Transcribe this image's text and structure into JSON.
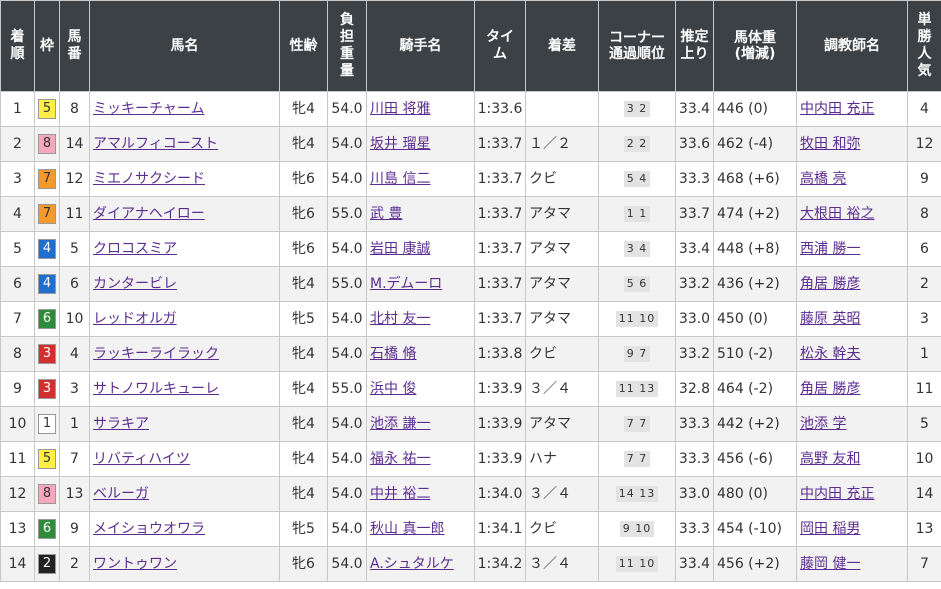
{
  "headers": {
    "rank": "着順",
    "waku": "枠",
    "umaban": "馬番",
    "horse": "馬名",
    "sexage": "性齢",
    "weight_carried": "負担重量",
    "jockey": "騎手名",
    "time": "タイム",
    "margin": "着差",
    "corner_line1": "コーナー",
    "corner_line2": "通過順位",
    "last3f": "推定上り",
    "body_line1": "馬体重",
    "body_line2": "(増減)",
    "trainer": "調教師名",
    "popularity": "単勝人気"
  },
  "waku_colors": {
    "1": {
      "bg": "#ffffff",
      "fg": "#333333"
    },
    "2": {
      "bg": "#222222",
      "fg": "#ffffff"
    },
    "3": {
      "bg": "#d32f2f",
      "fg": "#ffffff"
    },
    "4": {
      "bg": "#1f6fd1",
      "fg": "#ffffff"
    },
    "5": {
      "bg": "#ffee44",
      "fg": "#333333"
    },
    "6": {
      "bg": "#2e8b3a",
      "fg": "#ffffff"
    },
    "7": {
      "bg": "#f39a2b",
      "fg": "#333333"
    },
    "8": {
      "bg": "#f6a9be",
      "fg": "#333333"
    }
  },
  "rows": [
    {
      "rank": "1",
      "waku": "5",
      "umaban": "8",
      "horse": "ミッキーチャーム",
      "sexage": "牝4",
      "weight": "54.0",
      "jockey": "川田 将雅",
      "time": "1:33.6",
      "margin": "",
      "corner": "3 2",
      "last3f": "33.4",
      "body": "446 (0)",
      "trainer": "中内田 充正",
      "pop": "4"
    },
    {
      "rank": "2",
      "waku": "8",
      "umaban": "14",
      "horse": "アマルフィコースト",
      "sexage": "牝4",
      "weight": "54.0",
      "jockey": "坂井 瑠星",
      "time": "1:33.7",
      "margin": "１／２",
      "corner": "2 2",
      "last3f": "33.6",
      "body": "462 (-4)",
      "trainer": "牧田 和弥",
      "pop": "12"
    },
    {
      "rank": "3",
      "waku": "7",
      "umaban": "12",
      "horse": "ミエノサクシード",
      "sexage": "牝6",
      "weight": "54.0",
      "jockey": "川島 信二",
      "time": "1:33.7",
      "margin": "クビ",
      "corner": "5 4",
      "last3f": "33.3",
      "body": "468 (+6)",
      "trainer": "高橋 亮",
      "pop": "9"
    },
    {
      "rank": "4",
      "waku": "7",
      "umaban": "11",
      "horse": "ダイアナヘイロー",
      "sexage": "牝6",
      "weight": "55.0",
      "jockey": "武 豊",
      "time": "1:33.7",
      "margin": "アタマ",
      "corner": "1 1",
      "last3f": "33.7",
      "body": "474 (+2)",
      "trainer": "大根田 裕之",
      "pop": "8"
    },
    {
      "rank": "5",
      "waku": "4",
      "umaban": "5",
      "horse": "クロコスミア",
      "sexage": "牝6",
      "weight": "54.0",
      "jockey": "岩田 康誠",
      "time": "1:33.7",
      "margin": "アタマ",
      "corner": "3 4",
      "last3f": "33.4",
      "body": "448 (+8)",
      "trainer": "西浦 勝一",
      "pop": "6"
    },
    {
      "rank": "6",
      "waku": "4",
      "umaban": "6",
      "horse": "カンタービレ",
      "sexage": "牝4",
      "weight": "55.0",
      "jockey": "M.デムーロ",
      "time": "1:33.7",
      "margin": "アタマ",
      "corner": "5 6",
      "last3f": "33.2",
      "body": "436 (+2)",
      "trainer": "角居 勝彦",
      "pop": "2"
    },
    {
      "rank": "7",
      "waku": "6",
      "umaban": "10",
      "horse": "レッドオルガ",
      "sexage": "牝5",
      "weight": "54.0",
      "jockey": "北村 友一",
      "time": "1:33.7",
      "margin": "アタマ",
      "corner": "11 10",
      "last3f": "33.0",
      "body": "450 (0)",
      "trainer": "藤原 英昭",
      "pop": "3"
    },
    {
      "rank": "8",
      "waku": "3",
      "umaban": "4",
      "horse": "ラッキーライラック",
      "sexage": "牝4",
      "weight": "54.0",
      "jockey": "石橋 脩",
      "time": "1:33.8",
      "margin": "クビ",
      "corner": "9 7",
      "last3f": "33.2",
      "body": "510 (-2)",
      "trainer": "松永 幹夫",
      "pop": "1"
    },
    {
      "rank": "9",
      "waku": "3",
      "umaban": "3",
      "horse": "サトノワルキューレ",
      "sexage": "牝4",
      "weight": "55.0",
      "jockey": "浜中 俊",
      "time": "1:33.9",
      "margin": "３／４",
      "corner": "11 13",
      "last3f": "32.8",
      "body": "464 (-2)",
      "trainer": "角居 勝彦",
      "pop": "11"
    },
    {
      "rank": "10",
      "waku": "1",
      "umaban": "1",
      "horse": "サラキア",
      "sexage": "牝4",
      "weight": "54.0",
      "jockey": "池添 謙一",
      "time": "1:33.9",
      "margin": "アタマ",
      "corner": "7 7",
      "last3f": "33.3",
      "body": "442 (+2)",
      "trainer": "池添 学",
      "pop": "5"
    },
    {
      "rank": "11",
      "waku": "5",
      "umaban": "7",
      "horse": "リバティハイツ",
      "sexage": "牝4",
      "weight": "54.0",
      "jockey": "福永 祐一",
      "time": "1:33.9",
      "margin": "ハナ",
      "corner": "7 7",
      "last3f": "33.3",
      "body": "456 (-6)",
      "trainer": "高野 友和",
      "pop": "10"
    },
    {
      "rank": "12",
      "waku": "8",
      "umaban": "13",
      "horse": "ベルーガ",
      "sexage": "牝4",
      "weight": "54.0",
      "jockey": "中井 裕二",
      "time": "1:34.0",
      "margin": "３／４",
      "corner": "14 13",
      "last3f": "33.0",
      "body": "480 (0)",
      "trainer": "中内田 充正",
      "pop": "14"
    },
    {
      "rank": "13",
      "waku": "6",
      "umaban": "9",
      "horse": "メイショウオワラ",
      "sexage": "牝5",
      "weight": "54.0",
      "jockey": "秋山 真一郎",
      "time": "1:34.1",
      "margin": "クビ",
      "corner": "9 10",
      "last3f": "33.3",
      "body": "454 (-10)",
      "trainer": "岡田 稲男",
      "pop": "13"
    },
    {
      "rank": "14",
      "waku": "2",
      "umaban": "2",
      "horse": "ワントゥワン",
      "sexage": "牝6",
      "weight": "54.0",
      "jockey": "A.シュタルケ",
      "time": "1:34.2",
      "margin": "３／４",
      "corner": "11 10",
      "last3f": "33.4",
      "body": "456 (+2)",
      "trainer": "藤岡 健一",
      "pop": "7"
    }
  ]
}
